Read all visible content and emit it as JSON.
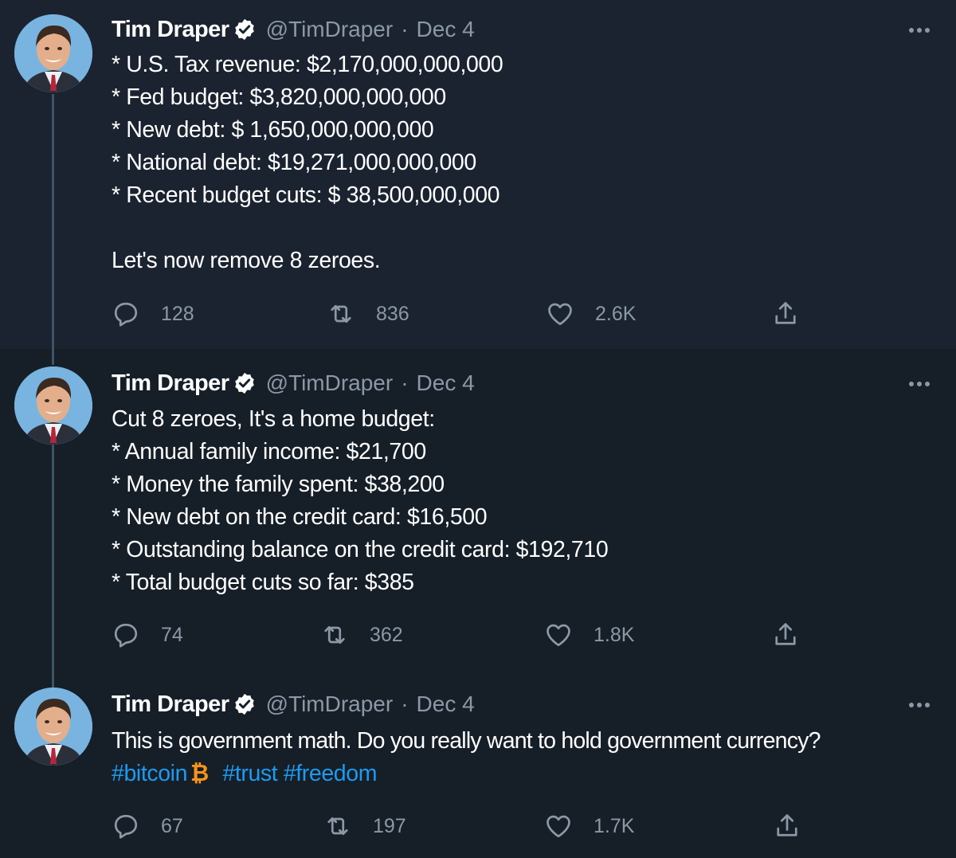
{
  "tweets": [
    {
      "author": {
        "name": "Tim Draper",
        "handle": "@TimDraper",
        "date": "Dec 4"
      },
      "lines": [
        "* U.S. Tax revenue: $2,170,000,000,000",
        "* Fed budget: $3,820,000,000,000",
        "* New debt: $ 1,650,000,000,000",
        "* National debt: $19,271,000,000,000",
        "* Recent budget cuts: $ 38,500,000,000",
        "",
        "Let's now remove 8 zeroes."
      ],
      "stats": {
        "replies": "128",
        "retweets": "836",
        "likes": "2.6K"
      }
    },
    {
      "author": {
        "name": "Tim Draper",
        "handle": "@TimDraper",
        "date": "Dec 4"
      },
      "lines": [
        "Cut 8 zeroes, It's a home budget:",
        "* Annual family income: $21,700",
        "* Money the family spent: $38,200",
        "* New debt on the credit card: $16,500",
        "* Outstanding balance on the credit card: $192,710",
        "* Total budget cuts so far: $385"
      ],
      "stats": {
        "replies": "74",
        "retweets": "362",
        "likes": "1.8K"
      }
    },
    {
      "author": {
        "name": "Tim Draper",
        "handle": "@TimDraper",
        "date": "Dec 4"
      },
      "lines": [
        "This is government math. Do you really want to hold government currency?"
      ],
      "hashtags": {
        "bitcoin": "#bitcoin",
        "bitcoin_emoji": "₿",
        "trust": "#trust",
        "freedom": "#freedom"
      },
      "stats": {
        "replies": "67",
        "retweets": "197",
        "likes": "1.7K"
      }
    }
  ],
  "icons": {
    "verified": "verified-badge-icon",
    "more": "more-options-icon",
    "reply": "reply-icon",
    "retweet": "retweet-icon",
    "like": "heart-icon",
    "share": "share-icon"
  },
  "colors": {
    "background": "#15202b",
    "text": "#ffffff",
    "muted": "#8b98a5",
    "link": "#1d9bf0",
    "thread_line": "#3d5466",
    "bitcoin": "#f7931a"
  }
}
